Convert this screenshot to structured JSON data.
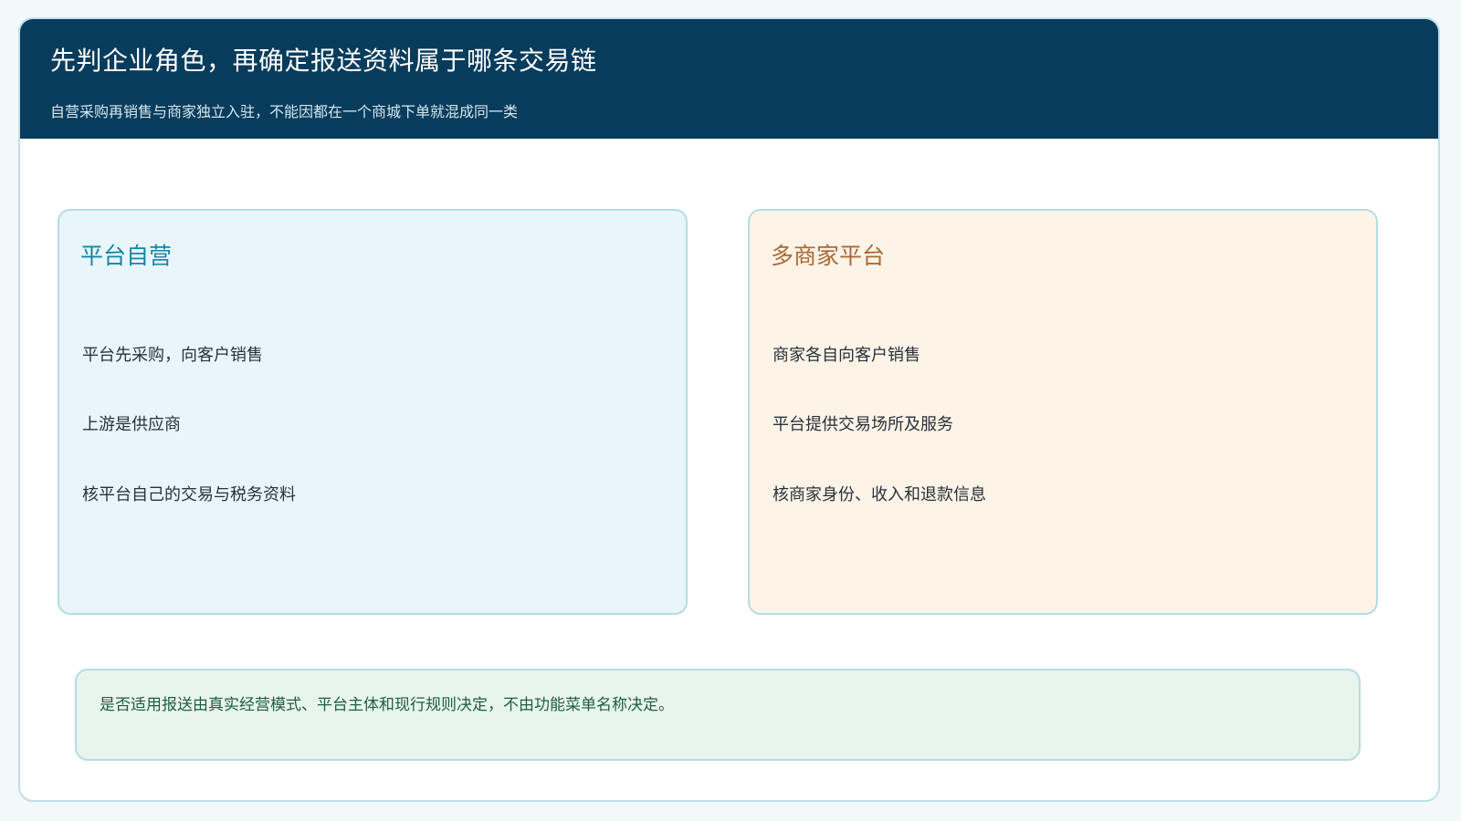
{
  "header": {
    "title": "先判企业角色，再确定报送资料属于哪条交易链",
    "subtitle": "自营采购再销售与商家独立入驻，不能因都在一个商城下单就混成同一类"
  },
  "cards": [
    {
      "title": "平台自营",
      "items": [
        "平台先采购，向客户销售",
        "上游是供应商",
        "核平台自己的交易与税务资料"
      ]
    },
    {
      "title": "多商家平台",
      "items": [
        "商家各自向客户销售",
        "平台提供交易场所及服务",
        "核商家身份、收入和退款信息"
      ]
    }
  ],
  "note": {
    "text": "是否适用报送由真实经营模式、平台主体和现行规则决定，不由功能菜单名称决定。"
  },
  "colors": {
    "header_bg": "#083c5c",
    "self_operated_card_bg": "#e8f6fa",
    "self_operated_title": "#1585a6",
    "marketplace_card_bg": "#fdf3e7",
    "marketplace_title": "#a96a37",
    "note_bg": "#e8f5ec",
    "note_text": "#1e5c43",
    "card_border": "#b6dbe6"
  }
}
